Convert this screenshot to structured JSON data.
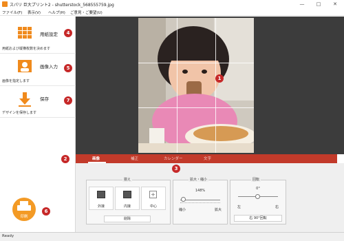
{
  "window": {
    "title": "スパリ 巨大プリント2 - shutterstock_568555759.jpg",
    "minimize_glyph": "—",
    "maximize_glyph": "□",
    "close_glyph": "✕"
  },
  "menu": {
    "items": [
      "ファイル(F)",
      "表示(V)",
      "ヘルプ(H)",
      "ご意見・ご要望(U)"
    ]
  },
  "sidebar": {
    "items": [
      {
        "label": "用紙設定",
        "desc": "用紙および縦横枚数を決めます",
        "icon": "grid-icon",
        "badge": "4"
      },
      {
        "label": "画像入力",
        "desc": "画像を指定します",
        "icon": "portrait-icon",
        "badge": "5"
      },
      {
        "label": "保存",
        "desc": "デザインを保存します",
        "icon": "download-arrow-icon",
        "badge": "7"
      }
    ],
    "print_label": "印刷",
    "print_badge": "6"
  },
  "canvas": {
    "badge": "1",
    "grid": "3x3"
  },
  "tabs": {
    "badge": "2",
    "items": [
      "画像",
      "補正",
      "カレンダー",
      "文字"
    ],
    "active": "画像"
  },
  "controls": {
    "badge": "3",
    "fit": {
      "title": "揃え",
      "options": [
        "外接",
        "内接",
        "中心"
      ],
      "delete_label": "削除"
    },
    "zoom": {
      "title": "拡大・縮小",
      "value_text": "148%",
      "min_label": "縮小",
      "max_label": "拡大"
    },
    "rotate": {
      "title": "回転",
      "value_text": "0°",
      "left_label": "左",
      "right_label": "右",
      "rotate_button": "右 90°回転"
    }
  },
  "status": {
    "text": "Ready"
  },
  "colors": {
    "accent_red": "#c23a2a",
    "accent_orange": "#f08a1c",
    "badge_red": "#c62828",
    "canvas_bg": "#3c3c3c"
  }
}
